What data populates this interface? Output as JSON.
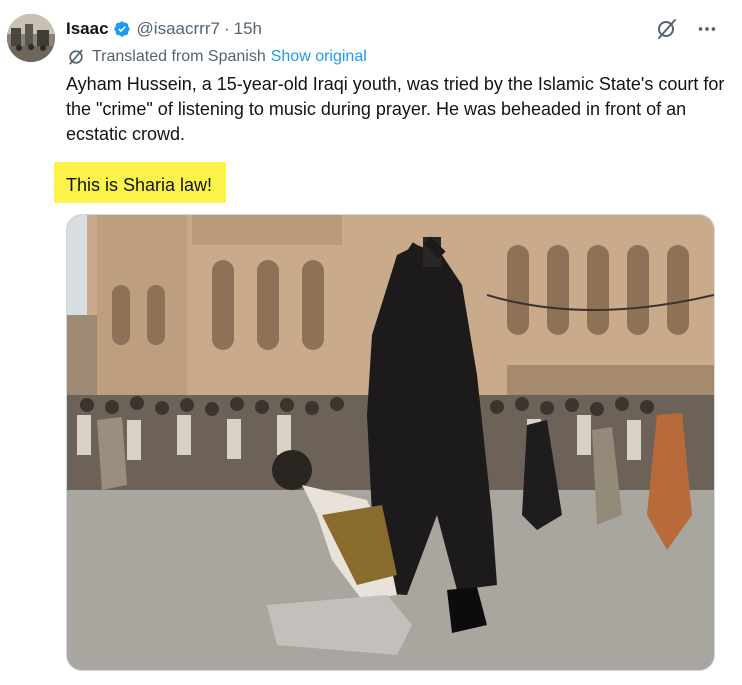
{
  "author": {
    "name": "Isaac",
    "handle": "@isaacrrr7",
    "time": "15h",
    "avatar_icon": "profile-photo",
    "verified_icon": "verified-badge-icon",
    "verified_color": "#1d9bf0"
  },
  "translation": {
    "label": "Translated from Spanish",
    "show_original": "Show original",
    "icon": "translate-icon"
  },
  "post": {
    "text": "Ayham Hussein, a 15-year-old Iraqi youth, was tried by the Islamic State's court for the \"crime\" of listening to music during prayer. He was beheaded in front of an ecstatic crowd.",
    "highlighted_text": "This is Sharia law!",
    "highlight_color": "#fbf34a"
  },
  "actions": {
    "grok_icon": "grok-icon",
    "more_icon": "more-options-icon"
  },
  "colors": {
    "text": "#0f1419",
    "secondary": "#536471",
    "link": "#1d9bf0"
  }
}
